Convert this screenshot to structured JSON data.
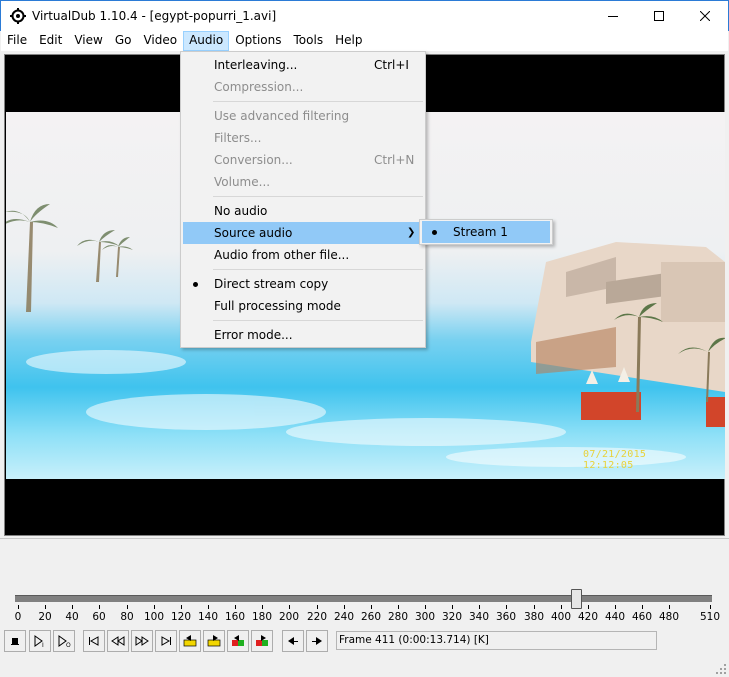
{
  "window": {
    "title": "VirtualDub 1.10.4 - [egypt-popurri_1.avi]"
  },
  "menubar": {
    "items": [
      "File",
      "Edit",
      "View",
      "Go",
      "Video",
      "Audio",
      "Options",
      "Tools",
      "Help"
    ],
    "active": "Audio"
  },
  "audio_menu": {
    "interleaving": "Interleaving...",
    "interleaving_shortcut": "Ctrl+I",
    "compression": "Compression...",
    "use_advanced_filtering": "Use advanced filtering",
    "filters": "Filters...",
    "conversion": "Conversion...",
    "conversion_shortcut": "Ctrl+N",
    "volume": "Volume...",
    "no_audio": "No audio",
    "source_audio": "Source audio",
    "audio_from_other_file": "Audio from other file...",
    "direct_stream_copy": "Direct stream copy",
    "full_processing_mode": "Full processing mode",
    "error_mode": "Error mode..."
  },
  "source_audio_submenu": {
    "stream1": "Stream 1"
  },
  "video": {
    "timestamp": "07/21/2015 12:12:05"
  },
  "timeline": {
    "ticks": [
      "0",
      "20",
      "40",
      "60",
      "80",
      "100",
      "120",
      "140",
      "160",
      "180",
      "200",
      "220",
      "240",
      "260",
      "280",
      "300",
      "320",
      "340",
      "360",
      "380",
      "400",
      "420",
      "440",
      "460",
      "480",
      "510"
    ],
    "position_frame": 411,
    "max_frame": 510
  },
  "status": {
    "text": "Frame 411 (0:00:13.714) [K]"
  },
  "colors": {
    "menu_highlight": "#91c9f7",
    "menubar_active": "#cce8ff",
    "timestamp": "#e8d23a"
  }
}
